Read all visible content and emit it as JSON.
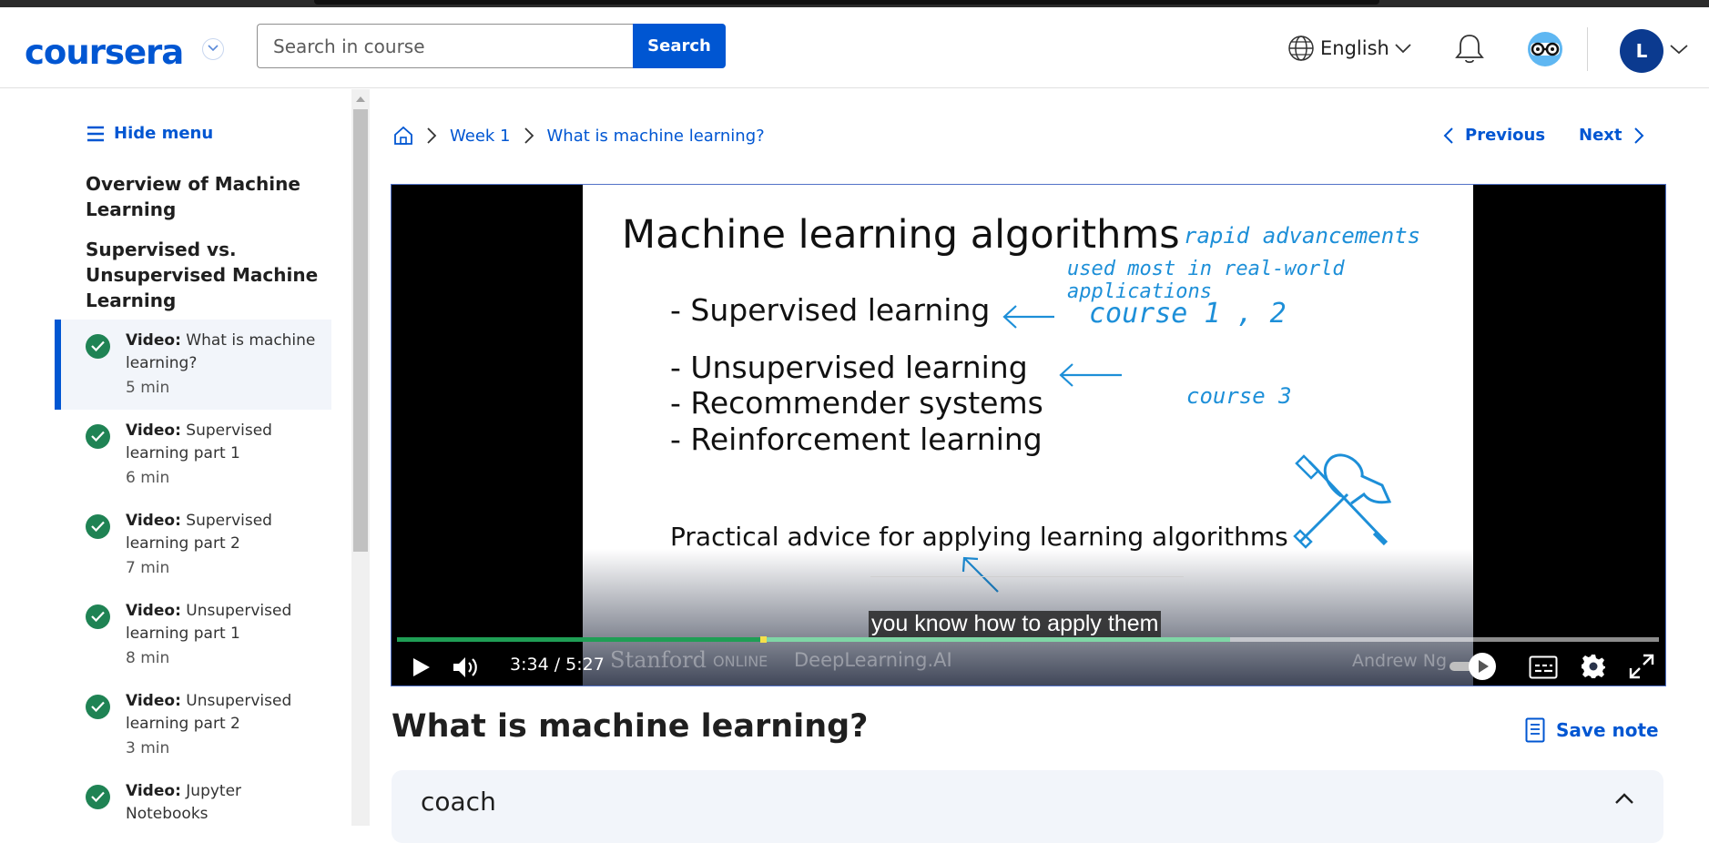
{
  "header": {
    "logo": "coursera",
    "search_placeholder": "Search in course",
    "search_button": "Search",
    "language": "English",
    "avatar_initial": "L"
  },
  "sidebar": {
    "hide_menu": "Hide menu",
    "sections": [
      "Overview of Machine Learning",
      "Supervised vs. Unsupervised Machine Learning"
    ],
    "section_lines": [
      [
        "Overview of Machine",
        "Learning"
      ],
      [
        "Supervised vs.",
        "Unsupervised Machine",
        "Learning"
      ]
    ],
    "items": [
      {
        "kind": "Video:",
        "title": "What is machine learning?",
        "duration": "5 min",
        "active": true,
        "completed": true
      },
      {
        "kind": "Video:",
        "title": "Supervised learning part 1",
        "duration": "6 min",
        "active": false,
        "completed": true
      },
      {
        "kind": "Video:",
        "title": "Supervised learning part 2",
        "duration": "7 min",
        "active": false,
        "completed": true
      },
      {
        "kind": "Video:",
        "title": "Unsupervised learning part 1",
        "duration": "8 min",
        "active": false,
        "completed": true
      },
      {
        "kind": "Video:",
        "title": "Unsupervised learning part 2",
        "duration": "3 min",
        "active": false,
        "completed": true
      },
      {
        "kind": "Video:",
        "title": "Jupyter Notebooks",
        "duration": "",
        "active": false,
        "completed": true
      }
    ]
  },
  "breadcrumb": {
    "week": "Week 1",
    "current": "What is machine learning?"
  },
  "nav": {
    "previous": "Previous",
    "next": "Next"
  },
  "video": {
    "slide_title": "Machine learning algorithms",
    "bullets": [
      "-  Supervised learning",
      "-  Unsupervised learning",
      "-  Recommender systems",
      "-  Reinforcement learning"
    ],
    "practical": "Practical advice for applying learning algorithms",
    "annotations": {
      "rapid": "rapid advancements",
      "used_most": "used most in real-world applications",
      "course12": "course 1 , 2",
      "course3": "course 3"
    },
    "caption": "you know how to apply them",
    "watermarks": {
      "stanford": "Stanford",
      "online": "ONLINE",
      "deeplearning": "DeepLearning.AI",
      "author": "Andrew Ng"
    },
    "current_time": "3:34",
    "separator": "/",
    "duration": "5:27",
    "played_fraction": 0.65,
    "buffered_fraction": 0.66
  },
  "lecture": {
    "title": "What is machine learning?",
    "save_note": "Save note"
  },
  "coach": {
    "title": "coach"
  },
  "colors": {
    "brand": "#0056d2",
    "complete_green": "#1f8354",
    "progress_green": "#1f9e55",
    "annotation_blue": "#1d8fd8"
  }
}
